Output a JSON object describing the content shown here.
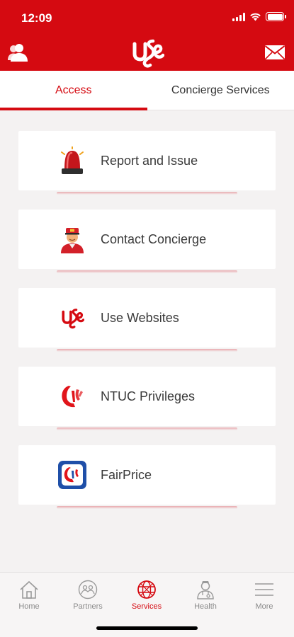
{
  "status_bar": {
    "time": "12:09"
  },
  "header": {
    "profile_icon": "person-icon",
    "logo_icon": "use-logo",
    "mail_icon": "mail-icon",
    "brand_color": "#d50a11"
  },
  "tabs": [
    {
      "label": "Access",
      "active": true
    },
    {
      "label": "Concierge Services",
      "active": false
    }
  ],
  "services": [
    {
      "label": "Report and Issue",
      "icon": "siren-icon"
    },
    {
      "label": "Contact Concierge",
      "icon": "concierge-icon"
    },
    {
      "label": "Use Websites",
      "icon": "use-logo-icon"
    },
    {
      "label": "NTUC Privileges",
      "icon": "ntuc-icon"
    },
    {
      "label": "FairPrice",
      "icon": "fairprice-icon"
    }
  ],
  "bottom_nav": [
    {
      "label": "Home",
      "icon": "home-icon",
      "active": false
    },
    {
      "label": "Partners",
      "icon": "partners-icon",
      "active": false
    },
    {
      "label": "Services",
      "icon": "globe-icon",
      "active": true
    },
    {
      "label": "Health",
      "icon": "doctor-icon",
      "active": false
    },
    {
      "label": "More",
      "icon": "menu-icon",
      "active": false
    }
  ]
}
